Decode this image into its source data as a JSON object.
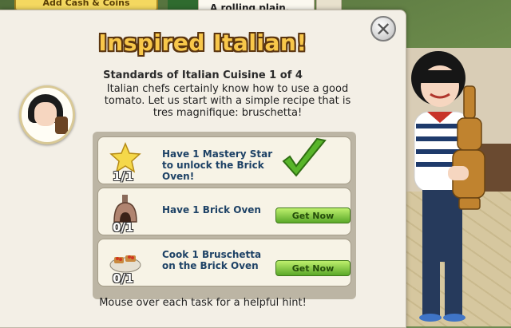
{
  "top_bar": {
    "add_cash_label": "Add Cash & Coins",
    "tooltip_text": "A rolling plain, Italian"
  },
  "dialog": {
    "title": "Inspired Italian!",
    "subtitle": "Standards of Italian Cuisine 1 of 4",
    "description": "Italian chefs certainly know how to use a good tomato. Let us start with a simple recipe that is tres magnifique: bruschetta!",
    "close_symbol": "✕",
    "hint": "Mouse over each task for a helpful hint!"
  },
  "tasks": [
    {
      "icon": "mastery-star-icon",
      "progress": "1/1",
      "label": "Have 1 Mastery Star to unlock the Brick Oven!",
      "status": "complete"
    },
    {
      "icon": "brick-oven-icon",
      "progress": "0/1",
      "label": "Have 1 Brick Oven",
      "button": "Get Now"
    },
    {
      "icon": "bruschetta-icon",
      "progress": "0/1",
      "label": "Cook 1 Bruschetta on the Brick Oven",
      "button": "Get Now"
    }
  ],
  "colors": {
    "title_fill": "#f8c74a",
    "title_outline": "#5a3510",
    "task_text": "#1e4266",
    "button_green": "#5aa828"
  }
}
